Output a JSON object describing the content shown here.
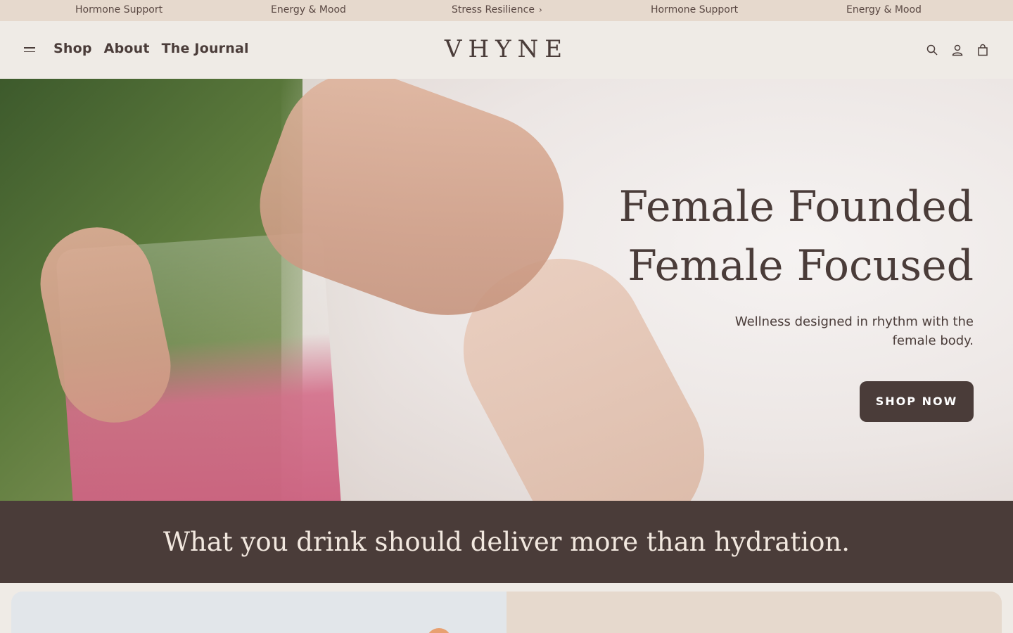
{
  "announcement": {
    "items": [
      "Hormone Support",
      "Energy & Mood",
      "Stress Resilience",
      "Hormone Support",
      "Energy & Mood"
    ]
  },
  "header": {
    "nav": [
      "Shop",
      "About",
      "The Journal"
    ],
    "logo": "VHYNE"
  },
  "hero": {
    "title_line1": "Female Founded",
    "title_line2": "Female Focused",
    "subtitle": "Wellness designed in rhythm with the female body.",
    "cta": "SHOP NOW"
  },
  "banner": {
    "headline": "What you drink should deliver more than hydration."
  },
  "colors": {
    "brand_dark": "#4a3c39",
    "announcement_bg": "#e6d9cd",
    "page_bg": "#efebe6"
  }
}
